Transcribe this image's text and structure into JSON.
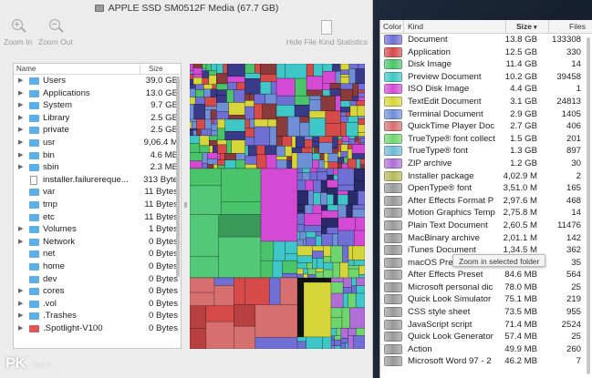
{
  "window": {
    "title": "APPLE SSD SM0512F Media (67.7 GB)"
  },
  "toolbar": {
    "zoom_in": "Zoom In",
    "zoom_out": "Zoom Out",
    "hide_kind": "Hide File Kind Statistics"
  },
  "file_list": {
    "header_name": "Name",
    "header_size": "Size",
    "rows": [
      {
        "name": "Users",
        "size": "39.0 GB",
        "icon": "folder-icon",
        "expandable": true
      },
      {
        "name": "Applications",
        "size": "13.0 GB",
        "icon": "folder-icon",
        "expandable": true
      },
      {
        "name": "System",
        "size": "9.7 GB",
        "icon": "folder-icon",
        "expandable": true
      },
      {
        "name": "Library",
        "size": "2.5 GB",
        "icon": "folder-icon",
        "expandable": true
      },
      {
        "name": "private",
        "size": "2.5 GB",
        "icon": "folder-icon",
        "expandable": true
      },
      {
        "name": "usr",
        "size": "9,06.4 M",
        "icon": "folder-icon",
        "expandable": true
      },
      {
        "name": "bin",
        "size": "4.6 MB",
        "icon": "folder-icon",
        "expandable": true
      },
      {
        "name": "sbin",
        "size": "2.3 MB",
        "icon": "folder-icon",
        "expandable": true
      },
      {
        "name": "installer.failurereque...",
        "size": "313 Byte",
        "icon": "file-icon",
        "expandable": false
      },
      {
        "name": "var",
        "size": "11 Bytes",
        "icon": "alias-folder-icon",
        "expandable": false
      },
      {
        "name": "tmp",
        "size": "11 Bytes",
        "icon": "alias-folder-icon",
        "expandable": false
      },
      {
        "name": "etc",
        "size": "11 Bytes",
        "icon": "alias-folder-icon",
        "expandable": false
      },
      {
        "name": "Volumes",
        "size": "1 Bytes",
        "icon": "folder-icon",
        "expandable": true
      },
      {
        "name": "Network",
        "size": "0 Bytes",
        "icon": "folder-icon",
        "expandable": true
      },
      {
        "name": "net",
        "size": "0 Bytes",
        "icon": "folder-icon",
        "expandable": false
      },
      {
        "name": "home",
        "size": "0 Bytes",
        "icon": "folder-icon",
        "expandable": false
      },
      {
        "name": "dev",
        "size": "0 Bytes",
        "icon": "folder-icon",
        "expandable": false
      },
      {
        "name": "cores",
        "size": "0 Bytes",
        "icon": "folder-icon",
        "expandable": true
      },
      {
        "name": ".vol",
        "size": "0 Bytes",
        "icon": "folder-icon",
        "expandable": true
      },
      {
        "name": ".Trashes",
        "size": "0 Bytes",
        "icon": "folder-icon",
        "expandable": true
      },
      {
        "name": ".Spotlight-V100",
        "size": "0 Bytes",
        "icon": "restricted-folder-icon",
        "expandable": true
      }
    ]
  },
  "kind_stats": {
    "header_color": "Color",
    "header_kind": "Kind",
    "header_size": "Size",
    "header_files": "Files",
    "rows": [
      {
        "kind": "Document",
        "size": "13.8 GB",
        "files": "133308",
        "color": "#6f6fd6"
      },
      {
        "kind": "Application",
        "size": "12.5 GB",
        "files": "330",
        "color": "#d64a4a"
      },
      {
        "kind": "Disk Image",
        "size": "11.4 GB",
        "files": "14",
        "color": "#4ac46a"
      },
      {
        "kind": "Preview Document",
        "size": "10.2 GB",
        "files": "39458",
        "color": "#3fc6c6"
      },
      {
        "kind": "ISO Disk Image",
        "size": "4.4 GB",
        "files": "1",
        "color": "#d44ad4"
      },
      {
        "kind": "TextEdit Document",
        "size": "3.1 GB",
        "files": "24813",
        "color": "#d6d63a"
      },
      {
        "kind": "Terminal Document",
        "size": "2.9 GB",
        "files": "1405",
        "color": "#6f8fd6"
      },
      {
        "kind": "QuickTime Player Doc",
        "size": "2.7 GB",
        "files": "406",
        "color": "#d66f6f"
      },
      {
        "kind": "TrueType® font collect",
        "size": "1.5 GB",
        "files": "201",
        "color": "#6fd66f"
      },
      {
        "kind": "TrueType® font",
        "size": "1.3 GB",
        "files": "897",
        "color": "#6fbad6"
      },
      {
        "kind": "ZIP archive",
        "size": "1.2 GB",
        "files": "30",
        "color": "#b06fd6"
      },
      {
        "kind": "Installer package",
        "size": "4,02.9 M",
        "files": "2",
        "color": "#b8b85a"
      },
      {
        "kind": "OpenType® font",
        "size": "3,51.0 M",
        "files": "165",
        "color": "#9a9a9a"
      },
      {
        "kind": "After Effects Format P",
        "size": "2,97.6 M",
        "files": "468",
        "color": "#9a9a9a"
      },
      {
        "kind": "Motion Graphics Temp",
        "size": "2,75.8 M",
        "files": "14",
        "color": "#9a9a9a"
      },
      {
        "kind": "Plain Text Document",
        "size": "2,60.5 M",
        "files": "11476",
        "color": "#9a9a9a"
      },
      {
        "kind": "MacBinary archive",
        "size": "2,01.1 M",
        "files": "142",
        "color": "#9a9a9a"
      },
      {
        "kind": "iTunes Document",
        "size": "1,34.5 M",
        "files": "362",
        "color": "#9a9a9a"
      },
      {
        "kind": "macOS Pre",
        "size": "",
        "files": "35",
        "color": "#9a9a9a"
      },
      {
        "kind": "After Effects Preset",
        "size": "84.6 MB",
        "files": "564",
        "color": "#9a9a9a"
      },
      {
        "kind": "Microsoft personal dic",
        "size": "78.0 MB",
        "files": "25",
        "color": "#9a9a9a"
      },
      {
        "kind": "Quick Look Simulator",
        "size": "75.1 MB",
        "files": "219",
        "color": "#9a9a9a"
      },
      {
        "kind": "CSS style sheet",
        "size": "73.5 MB",
        "files": "955",
        "color": "#9a9a9a"
      },
      {
        "kind": "JavaScript script",
        "size": "71.4 MB",
        "files": "2524",
        "color": "#9a9a9a"
      },
      {
        "kind": "Quick Look Generator",
        "size": "57.4 MB",
        "files": "25",
        "color": "#9a9a9a"
      },
      {
        "kind": "Action",
        "size": "49.9 MB",
        "files": "260",
        "color": "#9a9a9a"
      },
      {
        "kind": "Microsoft Word 97 - 2",
        "size": "46.2 MB",
        "files": "7",
        "color": "#9a9a9a"
      }
    ]
  },
  "tooltip": {
    "text": "Zoom in selected folder"
  },
  "watermark": {
    "letters": "PK",
    "sub": "痞客邦"
  }
}
